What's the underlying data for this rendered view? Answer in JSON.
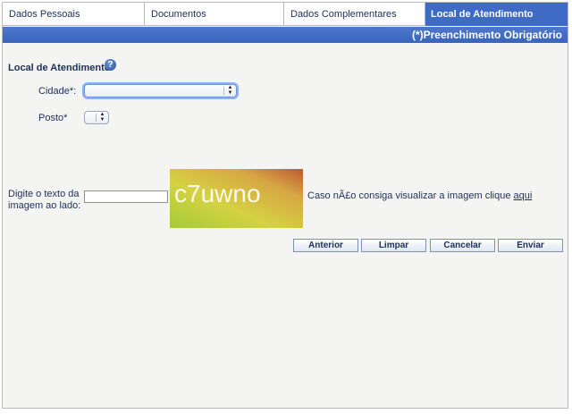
{
  "tabs": [
    {
      "label": "Dados Pessoais",
      "active": false
    },
    {
      "label": "Documentos",
      "active": false
    },
    {
      "label": "Dados Complementares",
      "active": false
    },
    {
      "label": "Local de Atendimento",
      "active": true
    }
  ],
  "required_note": "(*)Preenchimento Obrigatório",
  "section": {
    "title": "Local de Atendimento",
    "help_icon": "question-mark-icon"
  },
  "fields": {
    "cidade": {
      "label": "Cidade*:",
      "value": ""
    },
    "posto": {
      "label": "Posto*",
      "value": ""
    }
  },
  "captcha": {
    "label_line1": "Digite o texto da",
    "label_line2": "imagem ao lado:",
    "input_value": "",
    "image_text": "c7uwno",
    "help_text": "Caso nÃ£o consiga visualizar a imagem clique ",
    "help_link": "aqui"
  },
  "buttons": {
    "anterior": "Anterior",
    "limpar": "Limpar",
    "cancelar": "Cancelar",
    "enviar": "Enviar"
  },
  "colors": {
    "accent": "#3f6bc4",
    "text": "#1c2f57",
    "panel_bg": "#f4f4f2"
  }
}
